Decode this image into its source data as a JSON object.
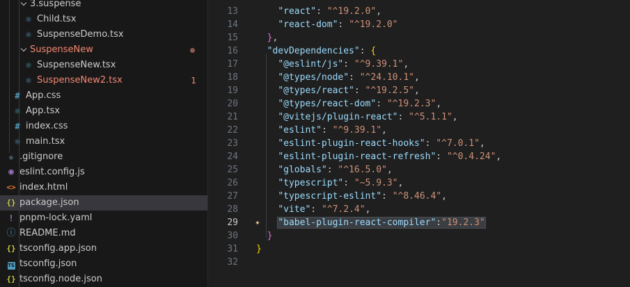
{
  "explorer": {
    "items": [
      {
        "label": "3.suspense",
        "type": "folder",
        "depth": 2,
        "icon": "chevron-down-icon"
      },
      {
        "label": "Child.tsx",
        "type": "file",
        "depth": 3,
        "icon": "react-icon"
      },
      {
        "label": "SuspenseDemo.tsx",
        "type": "file",
        "depth": 3,
        "icon": "react-icon"
      },
      {
        "label": "SuspenseNew",
        "type": "folder",
        "depth": 2,
        "icon": "chevron-down-icon",
        "status": "error-dot"
      },
      {
        "label": "SuspenseNew.tsx",
        "type": "file",
        "depth": 3,
        "icon": "react-icon"
      },
      {
        "label": "SuspenseNew2.tsx",
        "type": "file",
        "depth": 3,
        "icon": "react-icon",
        "status": "error",
        "badge": "1"
      },
      {
        "label": "App.css",
        "type": "file",
        "depth": 1,
        "icon": "hash-icon"
      },
      {
        "label": "App.tsx",
        "type": "file",
        "depth": 1,
        "icon": "react-icon"
      },
      {
        "label": "index.css",
        "type": "file",
        "depth": 1,
        "icon": "hash-icon"
      },
      {
        "label": "main.tsx",
        "type": "file",
        "depth": 1,
        "icon": "react-icon"
      },
      {
        "label": ".gitignore",
        "type": "file",
        "depth": 0,
        "icon": "git-icon"
      },
      {
        "label": "eslint.config.js",
        "type": "file",
        "depth": 0,
        "icon": "eslint-icon"
      },
      {
        "label": "index.html",
        "type": "file",
        "depth": 0,
        "icon": "html-icon"
      },
      {
        "label": "package.json",
        "type": "file",
        "depth": 0,
        "icon": "json-icon",
        "selected": true
      },
      {
        "label": "pnpm-lock.yaml",
        "type": "file",
        "depth": 0,
        "icon": "yaml-icon"
      },
      {
        "label": "README.md",
        "type": "file",
        "depth": 0,
        "icon": "info-icon"
      },
      {
        "label": "tsconfig.app.json",
        "type": "file",
        "depth": 0,
        "icon": "json-icon"
      },
      {
        "label": "tsconfig.json",
        "type": "file",
        "depth": 0,
        "icon": "typescript-icon"
      },
      {
        "label": "tsconfig.node.json",
        "type": "file",
        "depth": 0,
        "icon": "json-icon"
      }
    ]
  },
  "editor": {
    "active_line": 29,
    "lines": [
      {
        "n": "13",
        "text": "    \"react\": \"^19.2.0\","
      },
      {
        "n": "14",
        "text": "    \"react-dom\": \"^19.2.0\""
      },
      {
        "n": "15",
        "text": "  },"
      },
      {
        "n": "16",
        "text": "  \"devDependencies\": {"
      },
      {
        "n": "17",
        "text": "    \"@eslint/js\": \"^9.39.1\","
      },
      {
        "n": "18",
        "text": "    \"@types/node\": \"^24.10.1\","
      },
      {
        "n": "19",
        "text": "    \"@types/react\": \"^19.2.5\","
      },
      {
        "n": "20",
        "text": "    \"@types/react-dom\": \"^19.2.3\","
      },
      {
        "n": "21",
        "text": "    \"@vitejs/plugin-react\": \"^5.1.1\","
      },
      {
        "n": "22",
        "text": "    \"eslint\": \"^9.39.1\","
      },
      {
        "n": "23",
        "text": "    \"eslint-plugin-react-hooks\": \"^7.0.1\","
      },
      {
        "n": "24",
        "text": "    \"eslint-plugin-react-refresh\": \"^0.4.24\","
      },
      {
        "n": "25",
        "text": "    \"globals\": \"^16.5.0\","
      },
      {
        "n": "26",
        "text": "    \"typescript\": \"~5.9.3\","
      },
      {
        "n": "27",
        "text": "    \"typescript-eslint\": \"^8.46.4\","
      },
      {
        "n": "28",
        "text": "    \"vite\": \"^7.2.4\","
      },
      {
        "n": "29",
        "text": "    \"babel-plugin-react-compiler\":\"19.2.3\""
      },
      {
        "n": "30",
        "text": "  }"
      },
      {
        "n": "31",
        "text": "}"
      },
      {
        "n": "32",
        "text": ""
      }
    ]
  },
  "colors": {
    "sidebar_bg": "#181818",
    "editor_bg": "#1f1f1f",
    "selection_bg": "#37373d",
    "error_text": "#f48771",
    "json_key": "#9cdcfe",
    "json_string": "#ce9178"
  }
}
